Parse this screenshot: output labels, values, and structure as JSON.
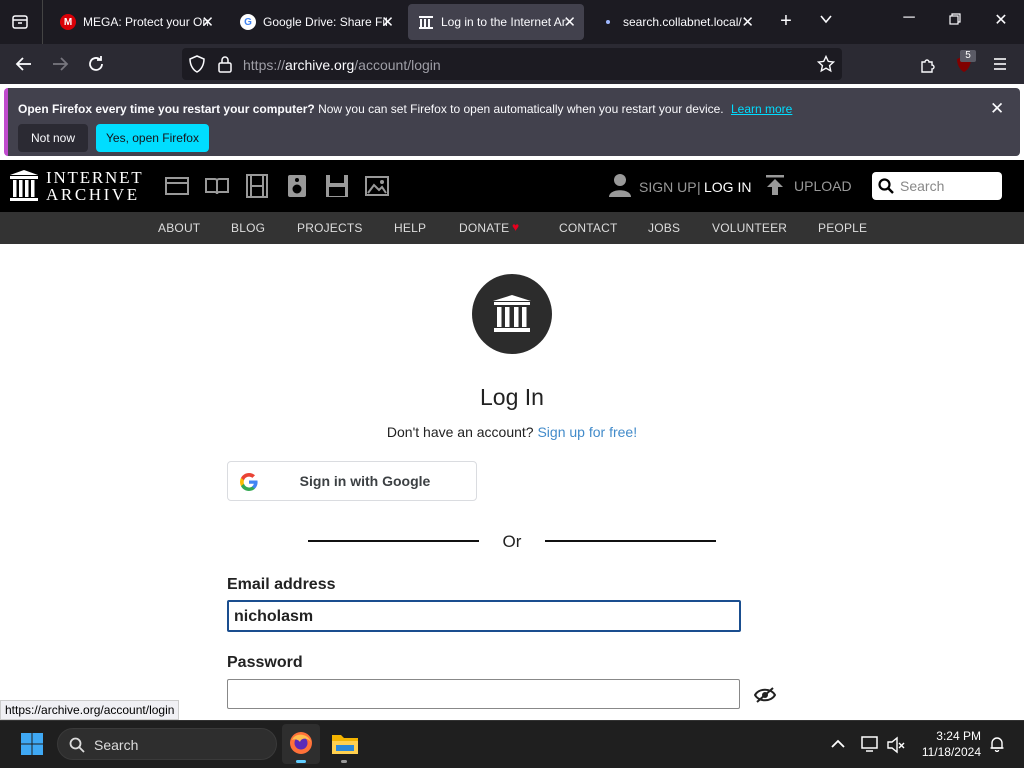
{
  "tabs": [
    {
      "title": "MEGA: Protect your Online Privacy",
      "favicon": "M",
      "active": false
    },
    {
      "title": "Google Drive: Share Files Online",
      "favicon": "G",
      "active": false
    },
    {
      "title": "Log in to the Internet Archive",
      "favicon": "IA",
      "active": true
    },
    {
      "title": "search.collabnet.local/",
      "favicon": "dot",
      "active": false
    }
  ],
  "url": {
    "prefix": "https://",
    "host": "archive.org",
    "path": "/account/login"
  },
  "extension_badge": "5",
  "notification": {
    "bold": "Open Firefox every time you restart your computer?",
    "text": "Now you can set Firefox to open automatically when you restart your device.",
    "link": "Learn more",
    "btn_secondary": "Not now",
    "btn_primary": "Yes, open Firefox"
  },
  "ia": {
    "logo_line1": "INTERNET",
    "logo_line2": "ARCHIVE",
    "signup": "SIGN UP",
    "separator": "|",
    "login": "LOG IN",
    "upload": "UPLOAD",
    "search_placeholder": "Search",
    "nav": [
      "ABOUT",
      "BLOG",
      "PROJECTS",
      "HELP",
      "DONATE",
      "CONTACT",
      "JOBS",
      "VOLUNTEER",
      "PEOPLE"
    ]
  },
  "login": {
    "heading": "Log In",
    "no_account": "Don't have an account?",
    "signup_link": "Sign up for free!",
    "google_btn": "Sign in with Google",
    "or": "Or",
    "email_label": "Email address",
    "email_value": "nicholasm",
    "password_label": "Password",
    "password_value": ""
  },
  "status_tip": "https://archive.org/account/login",
  "taskbar": {
    "search": "Search",
    "time": "3:24 PM",
    "date": "11/18/2024"
  },
  "colors": {
    "accent_link": "#428bca",
    "firefox_primary": "#00ddff",
    "focus_border": "#1a4e8f"
  }
}
